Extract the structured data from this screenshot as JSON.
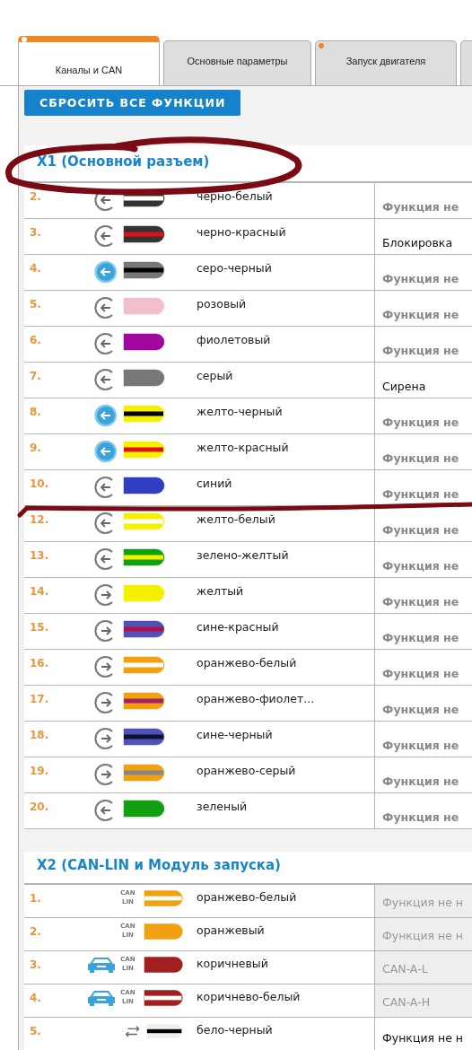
{
  "tabs": [
    {
      "label": "Каналы и CAN",
      "selected": true,
      "modified": false
    },
    {
      "label": "Основные параметры",
      "selected": false,
      "modified": false
    },
    {
      "label": "Запуск двигателя",
      "selected": false,
      "modified": true
    },
    {
      "selected": false,
      "modified": false
    }
  ],
  "reset_button": "СБРОСИТЬ ВСЕ ФУНКЦИИ",
  "sections": [
    {
      "title": "X1 (Основной разъем)",
      "kind": "main",
      "rows": [
        {
          "number": "2.",
          "kind": "in",
          "active": false,
          "color": "#333333",
          "stripe": {
            "color": "#ffffff"
          },
          "name": "черно-белый",
          "function": {
            "text": "Функция не",
            "kind": "default"
          }
        },
        {
          "number": "3.",
          "kind": "in",
          "active": false,
          "color": "#333333",
          "stripe": {
            "color": "#e0101a"
          },
          "name": "черно-красный",
          "function": {
            "text": "Блокировка",
            "kind": "assigned"
          }
        },
        {
          "number": "4.",
          "kind": "in",
          "active": true,
          "color": "#777777",
          "stripe": {
            "color": "#000000"
          },
          "name": "серо-черный",
          "function": {
            "text": "Функция не",
            "kind": "default"
          }
        },
        {
          "number": "5.",
          "kind": "in",
          "active": false,
          "color": "#f2bfcc",
          "name": "розовый",
          "function": {
            "text": "Функция не",
            "kind": "default"
          }
        },
        {
          "number": "6.",
          "kind": "in",
          "active": false,
          "color": "#a0079f",
          "name": "фиолетовый",
          "function": {
            "text": "Функция не",
            "kind": "default"
          }
        },
        {
          "number": "7.",
          "kind": "in",
          "active": false,
          "color": "#777777",
          "name": "серый",
          "function": {
            "text": "Сирена",
            "kind": "assigned"
          }
        },
        {
          "number": "8.",
          "kind": "in",
          "active": true,
          "color": "#f5f000",
          "stripe": {
            "color": "#000000"
          },
          "name": "желто-черный",
          "function": {
            "text": "Функция не",
            "kind": "default"
          }
        },
        {
          "number": "9.",
          "kind": "in",
          "active": true,
          "color": "#f5f000",
          "stripe": {
            "color": "#e0101a"
          },
          "name": "желто-красный",
          "function": {
            "text": "Функция не",
            "kind": "default"
          }
        },
        {
          "number": "10.",
          "kind": "in",
          "active": false,
          "color": "#2f3fc0",
          "name": "синий",
          "function": {
            "text": "Функция не",
            "kind": "default"
          }
        },
        {
          "number": "12.",
          "kind": "in",
          "active": false,
          "color": "#f5f000",
          "stripe": {
            "color": "#ffffff"
          },
          "name": "желто-белый",
          "function": {
            "text": "Функция не",
            "kind": "default"
          }
        },
        {
          "number": "13.",
          "kind": "in",
          "active": false,
          "color": "#10a010",
          "stripe": {
            "color": "#f5f000"
          },
          "name": "зелено-желтый",
          "function": {
            "text": "Функция не",
            "kind": "default"
          }
        },
        {
          "number": "14.",
          "kind": "out",
          "active": false,
          "color": "#f5f000",
          "name": "желтый",
          "function": {
            "text": "Функция не",
            "kind": "default"
          }
        },
        {
          "number": "15.",
          "kind": "out",
          "active": false,
          "color": "#5050b8",
          "stripe": {
            "color": "#b0104a"
          },
          "name": "сине-красный",
          "function": {
            "text": "Функция не",
            "kind": "default"
          }
        },
        {
          "number": "16.",
          "kind": "out",
          "active": false,
          "color": "#f0a010",
          "stripe": {
            "color": "#ffffff"
          },
          "name": "оранжево-белый",
          "function": {
            "text": "Функция не",
            "kind": "default"
          }
        },
        {
          "number": "17.",
          "kind": "out",
          "active": false,
          "color": "#f0a010",
          "stripe": {
            "color": "#a0206a"
          },
          "name": "оранжево-фиолет...",
          "function": {
            "text": "Функция не",
            "kind": "default"
          }
        },
        {
          "number": "18.",
          "kind": "out",
          "active": false,
          "color": "#5050b8",
          "stripe": {
            "color": "#101030"
          },
          "name": "сине-черный",
          "function": {
            "text": "Функция не",
            "kind": "default"
          }
        },
        {
          "number": "19.",
          "kind": "out",
          "active": false,
          "color": "#f0a010",
          "stripe": {
            "color": "#888888"
          },
          "name": "оранжево-серый",
          "function": {
            "text": "Функция не",
            "kind": "default"
          }
        },
        {
          "number": "20.",
          "kind": "in",
          "active": false,
          "color": "#10a010",
          "name": "зеленый",
          "function": {
            "text": "Функция не",
            "kind": "default"
          }
        }
      ]
    },
    {
      "title": "X2 (CAN-LIN и Модуль запуска)",
      "kind": "bus",
      "rows": [
        {
          "number": "1.",
          "kind": "can",
          "bus": [
            "CAN",
            "LIN"
          ],
          "car": false,
          "color": "#f0a010",
          "stripe": {
            "color": "#ffffff"
          },
          "name": "оранжево-белый",
          "function": {
            "text": "Функция не н",
            "kind": "locked"
          }
        },
        {
          "number": "2.",
          "kind": "can",
          "bus": [
            "CAN",
            "LIN"
          ],
          "car": false,
          "color": "#f0a010",
          "name": "оранжевый",
          "function": {
            "text": "Функция не н",
            "kind": "locked"
          }
        },
        {
          "number": "3.",
          "kind": "can",
          "bus": [
            "CAN",
            "LIN"
          ],
          "car": true,
          "color": "#a02020",
          "name": "коричневый",
          "function": {
            "text": "CAN-A-L",
            "kind": "locked"
          }
        },
        {
          "number": "4.",
          "kind": "can",
          "bus": [
            "CAN",
            "LIN"
          ],
          "car": true,
          "color": "#a02020",
          "stripe": {
            "color": "#ffffff"
          },
          "name": "коричнево-белый",
          "function": {
            "text": "CAN-A-H",
            "kind": "locked"
          }
        },
        {
          "number": "5.",
          "kind": "swap",
          "color": "#eeeeee",
          "stripe": {
            "color": "#000000"
          },
          "name": "бело-черный",
          "function": {
            "text": "Функция не н",
            "kind": "plain"
          }
        }
      ]
    }
  ],
  "annotations": {
    "header_circled": true,
    "row_struck": true
  }
}
